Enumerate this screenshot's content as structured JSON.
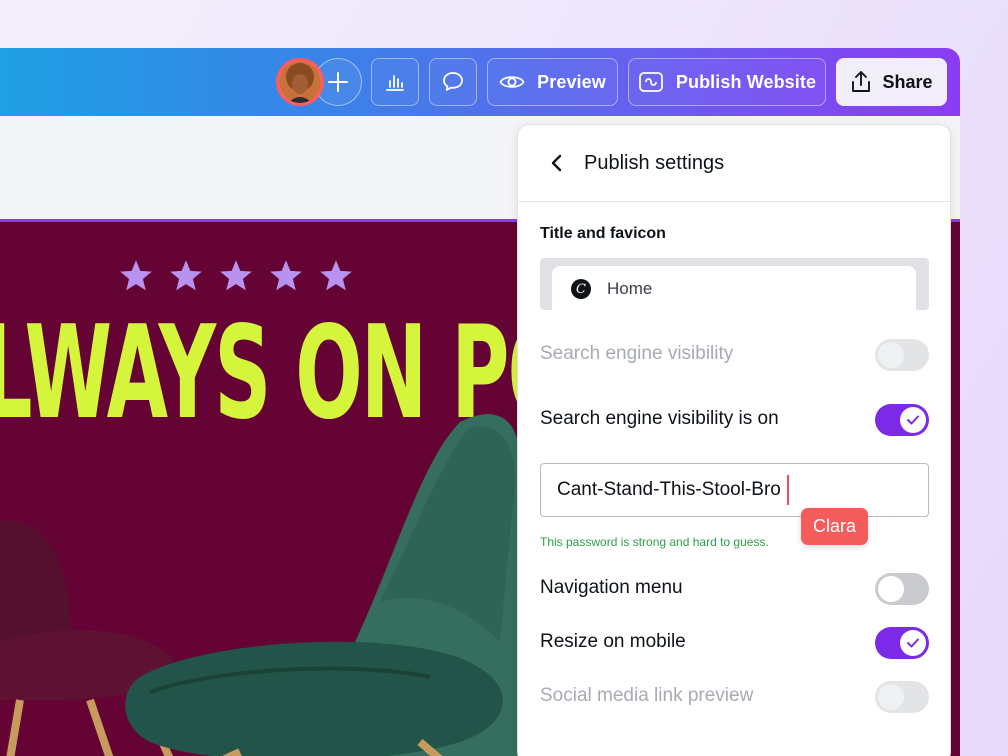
{
  "topbar": {
    "add_label": "+",
    "preview_label": "Preview",
    "publish_label": "Publish Website",
    "share_label": "Share"
  },
  "design": {
    "star_count": 5,
    "headline": "LWAYS ON POINT"
  },
  "panel": {
    "title": "Publish settings",
    "section_title": "Title and favicon",
    "favicon_letter": "C",
    "favicon_title": "Home",
    "rows": [
      {
        "label": "Search engine visibility",
        "state": "off",
        "disabled": true
      },
      {
        "label": "Search engine visibility is on",
        "state": "on",
        "disabled": false
      },
      {
        "label": "Navigation menu",
        "state": "off",
        "disabled": false
      },
      {
        "label": "Resize on mobile",
        "state": "on",
        "disabled": false
      },
      {
        "label": "Social media link preview",
        "state": "off",
        "disabled": true
      }
    ],
    "password_value": "Cant-Stand-This-Stool-Bro",
    "password_hint": "This password is strong and hard to guess."
  },
  "collaborator": {
    "name": "Clara",
    "color": "#f45b5b"
  },
  "colors": {
    "accent": "#7d2ae8",
    "headline": "#d4f53c",
    "design_bg": "#650434",
    "star": "#b792ef",
    "hint": "#2e9e48"
  }
}
